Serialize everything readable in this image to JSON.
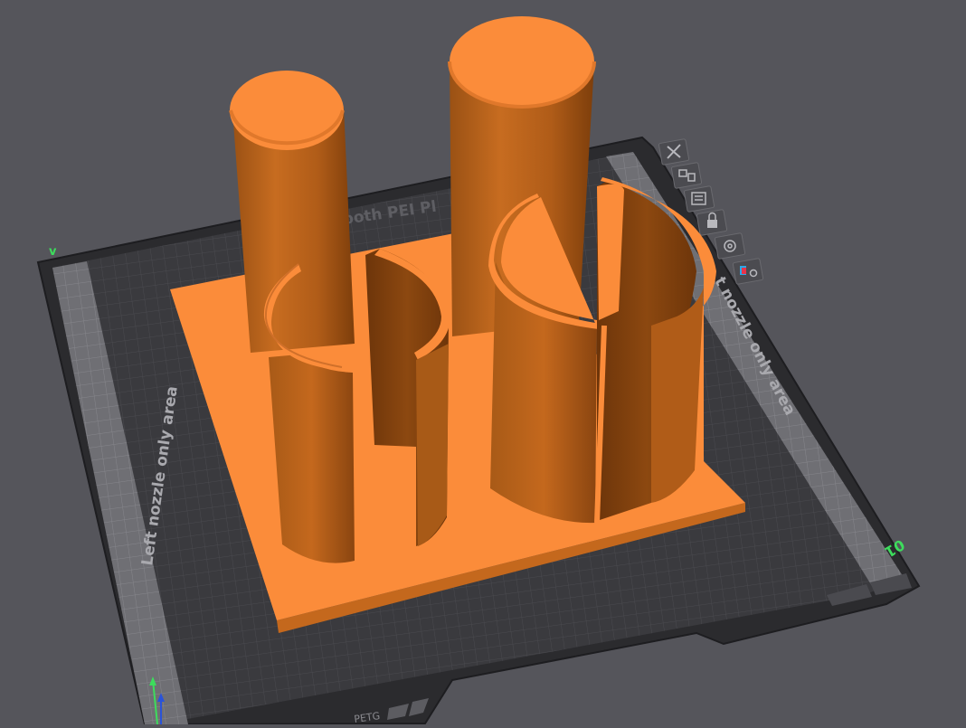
{
  "viewport": {
    "background": "#55555b",
    "bed": {
      "plate_label": "ooth PEI Pl",
      "left_zone_label": "Left nozzle only area",
      "right_zone_label": "t nozzle only area",
      "plate_number": "01",
      "corner_marker": "v",
      "filament_tag": "PETG"
    },
    "plate_tools": [
      {
        "name": "close-plate",
        "icon": "close-icon"
      },
      {
        "name": "arrange-objects",
        "icon": "arrange-icon"
      },
      {
        "name": "plate-settings",
        "icon": "settings-panel-icon"
      },
      {
        "name": "lock-plate",
        "icon": "lock-icon"
      },
      {
        "name": "auto-orient",
        "icon": "orient-icon"
      },
      {
        "name": "filament-map",
        "icon": "filament-map-icon"
      }
    ],
    "colors": {
      "model_top": "#fb8c3a",
      "model_side": "#c4681d",
      "model_dark": "#7d3e0b",
      "bed_inner": "#3a3a3e",
      "bed_zone": "#6f6f74",
      "accent_green": "#3ddc5c"
    }
  }
}
